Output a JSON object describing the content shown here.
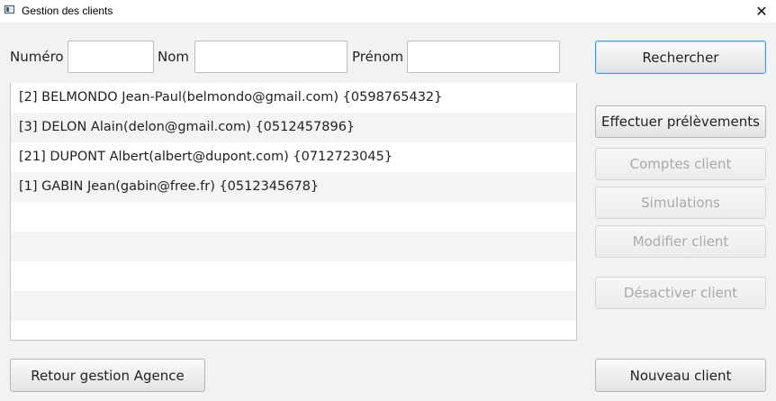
{
  "window": {
    "title": "Gestion des clients",
    "close_glyph": "✕"
  },
  "search": {
    "numero_label": "Numéro",
    "numero_value": "",
    "nom_label": "Nom",
    "nom_value": "",
    "prenom_label": "Prénom",
    "prenom_value": "",
    "search_button": "Rechercher"
  },
  "clients": [
    "[2]  BELMONDO Jean-Paul(belmondo@gmail.com)  {0598765432}",
    "[3]  DELON Alain(delon@gmail.com)  {0512457896}",
    "[21]  DUPONT Albert(albert@dupont.com)  {0712723045}",
    "[1]  GABIN Jean(gabin@free.fr)  {0512345678}",
    "",
    "",
    "",
    "",
    ""
  ],
  "actions": {
    "prelevements": "Effectuer prélèvements",
    "comptes": "Comptes client",
    "simulations": "Simulations",
    "modifier": "Modifier client",
    "desactiver": "Désactiver client",
    "retour": "Retour gestion Agence",
    "nouveau": "Nouveau client"
  }
}
